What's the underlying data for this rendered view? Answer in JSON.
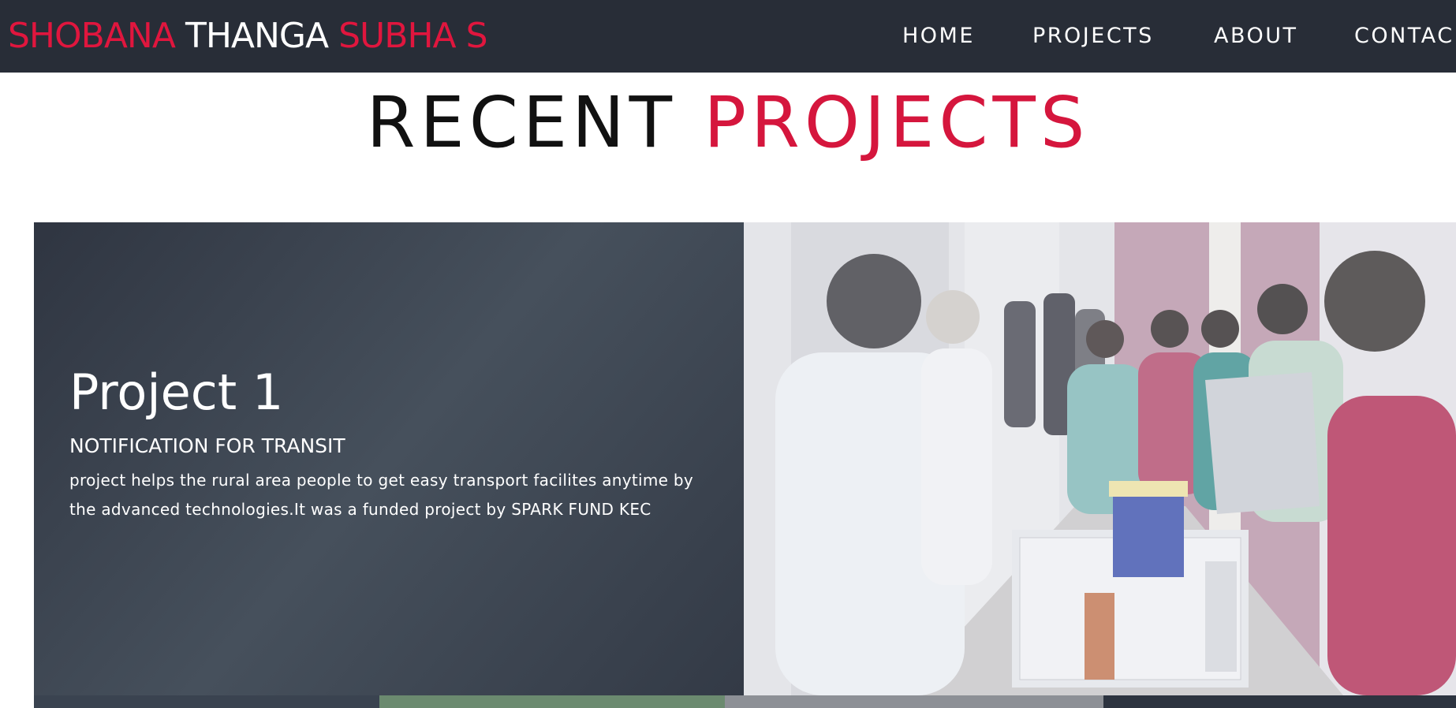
{
  "brand": {
    "first": "SHOBANA",
    "middle": "THANGA",
    "last": "SUBHA S"
  },
  "nav": {
    "items": [
      {
        "label": "HOME"
      },
      {
        "label": "PROJECTS"
      },
      {
        "label": "ABOUT"
      },
      {
        "label": "CONTAC"
      }
    ]
  },
  "section": {
    "title_part1": "RECENT",
    "title_part2": "PROJECTS"
  },
  "project": {
    "name": "Project 1",
    "subtitle": "NOTIFICATION FOR TRANSIT",
    "description": "project helps the rural area people to get easy transport facilites anytime by the advanced technologies.It was a funded project by SPARK FUND KEC"
  },
  "colors": {
    "navbar_bg": "#282d37",
    "accent_red": "#e0163e",
    "card_bg": "#3d4551",
    "white": "#ffffff"
  }
}
